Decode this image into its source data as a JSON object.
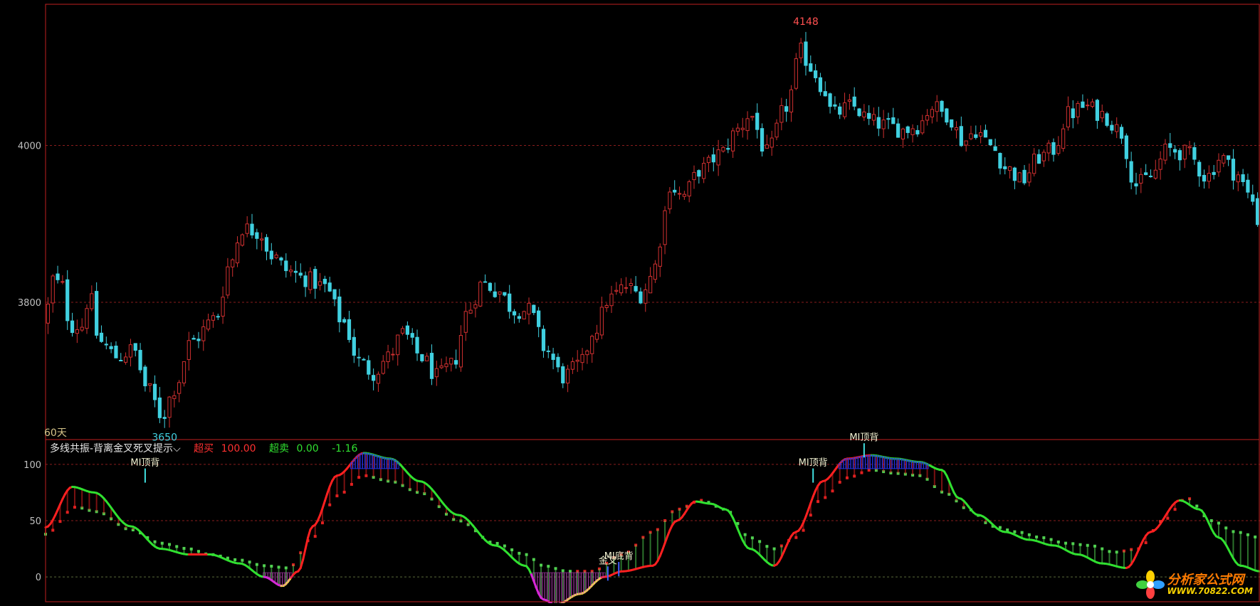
{
  "colors": {
    "up": "#d03030",
    "down": "#40d0e0",
    "frame": "#c02020",
    "grid": "#8a1c1c",
    "zero_grid": "#5a6a3a",
    "axis_text": "#c0c0c0",
    "fast_up": "#ff2020",
    "fast_down": "#30e030",
    "slow_up": "#e02020",
    "slow_down": "#50d050",
    "overbought_box": "#2030e0",
    "oversold_box": "#c040c0"
  },
  "price_panel": {
    "period_label": "60天",
    "high_label": "4148",
    "low_label": "3650"
  },
  "indicator_header": {
    "name": "多线共振-背离金叉死叉提示",
    "chevron": "⌵",
    "overbought_label": "超买",
    "overbought_value": "100.00",
    "oversold_label": "超卖",
    "oversold_value": "0.00",
    "current_value": "-1.16"
  },
  "annotations": [
    {
      "x": 82,
      "text": "MI顶背"
    },
    {
      "x": 463,
      "text": "金叉"
    },
    {
      "x": 472,
      "text": "MI底背"
    },
    {
      "x": 632,
      "text": "MI顶背"
    },
    {
      "x": 674,
      "text": "MI顶背"
    }
  ],
  "watermark": {
    "title": "分析家公式网",
    "url": "WWW.70822.COM"
  },
  "chart_data": [
    {
      "type": "candlestick",
      "y_ticks": [
        3800,
        4000
      ],
      "ylim": [
        3625,
        4180
      ],
      "grid": true,
      "x_range": [
        0,
        1000
      ],
      "price_anchors": [
        [
          0,
          3775
        ],
        [
          5,
          3830
        ],
        [
          14,
          3820
        ],
        [
          20,
          3770
        ],
        [
          30,
          3770
        ],
        [
          36,
          3810
        ],
        [
          44,
          3750
        ],
        [
          60,
          3730
        ],
        [
          72,
          3740
        ],
        [
          84,
          3690
        ],
        [
          96,
          3655
        ],
        [
          106,
          3690
        ],
        [
          120,
          3750
        ],
        [
          140,
          3780
        ],
        [
          152,
          3850
        ],
        [
          162,
          3895
        ],
        [
          176,
          3890
        ],
        [
          186,
          3860
        ],
        [
          200,
          3840
        ],
        [
          214,
          3830
        ],
        [
          230,
          3820
        ],
        [
          245,
          3775
        ],
        [
          258,
          3725
        ],
        [
          270,
          3710
        ],
        [
          282,
          3730
        ],
        [
          294,
          3760
        ],
        [
          310,
          3730
        ],
        [
          322,
          3705
        ],
        [
          335,
          3720
        ],
        [
          348,
          3790
        ],
        [
          360,
          3825
        ],
        [
          372,
          3815
        ],
        [
          386,
          3790
        ],
        [
          398,
          3790
        ],
        [
          412,
          3740
        ],
        [
          426,
          3705
        ],
        [
          440,
          3720
        ],
        [
          452,
          3765
        ],
        [
          464,
          3805
        ],
        [
          478,
          3820
        ],
        [
          490,
          3810
        ],
        [
          500,
          3835
        ],
        [
          506,
          3880
        ],
        [
          514,
          3950
        ],
        [
          524,
          3935
        ],
        [
          540,
          3970
        ],
        [
          556,
          3990
        ],
        [
          570,
          4020
        ],
        [
          580,
          4040
        ],
        [
          594,
          3990
        ],
        [
          610,
          4050
        ],
        [
          622,
          4120
        ],
        [
          630,
          4100
        ],
        [
          640,
          4075
        ],
        [
          648,
          4040
        ],
        [
          664,
          4050
        ],
        [
          680,
          4030
        ],
        [
          694,
          4025
        ],
        [
          706,
          4020
        ],
        [
          718,
          4025
        ],
        [
          730,
          4050
        ],
        [
          742,
          4040
        ],
        [
          756,
          4005
        ],
        [
          766,
          4020
        ],
        [
          778,
          4000
        ],
        [
          792,
          3970
        ],
        [
          804,
          3955
        ],
        [
          818,
          3985
        ],
        [
          830,
          3995
        ],
        [
          842,
          4040
        ],
        [
          856,
          4050
        ],
        [
          870,
          4040
        ],
        [
          884,
          4020
        ],
        [
          898,
          3950
        ],
        [
          910,
          3960
        ],
        [
          924,
          3995
        ],
        [
          940,
          3990
        ],
        [
          956,
          3960
        ],
        [
          968,
          3985
        ],
        [
          980,
          3965
        ],
        [
          992,
          3935
        ],
        [
          1000,
          3900
        ]
      ]
    },
    {
      "type": "line",
      "y_ticks": [
        0,
        50,
        100
      ],
      "ylim": [
        -22,
        122
      ],
      "grid": true,
      "x_range": [
        0,
        1000
      ],
      "series": [
        {
          "values": [
            [
              0,
              44
            ],
            [
              22,
              80
            ],
            [
              40,
              75
            ],
            [
              70,
              45
            ],
            [
              95,
              25
            ],
            [
              118,
              20
            ],
            [
              135,
              20
            ],
            [
              160,
              12
            ],
            [
              180,
              0
            ],
            [
              195,
              -8
            ],
            [
              208,
              5
            ],
            [
              220,
              45
            ],
            [
              240,
              90
            ],
            [
              262,
              110
            ],
            [
              284,
              105
            ],
            [
              308,
              85
            ],
            [
              340,
              55
            ],
            [
              370,
              28
            ],
            [
              395,
              10
            ],
            [
              410,
              -20
            ],
            [
              420,
              -25
            ],
            [
              440,
              -15
            ],
            [
              460,
              0
            ],
            [
              475,
              5
            ],
            [
              500,
              10
            ],
            [
              520,
              50
            ],
            [
              535,
              67
            ],
            [
              548,
              65
            ],
            [
              560,
              60
            ],
            [
              580,
              25
            ],
            [
              600,
              10
            ],
            [
              618,
              40
            ],
            [
              640,
              85
            ],
            [
              660,
              105
            ],
            [
              680,
              108
            ],
            [
              700,
              105
            ],
            [
              720,
              102
            ],
            [
              738,
              95
            ],
            [
              752,
              70
            ],
            [
              768,
              55
            ],
            [
              790,
              40
            ],
            [
              810,
              33
            ],
            [
              830,
              28
            ],
            [
              850,
              20
            ],
            [
              870,
              12
            ],
            [
              890,
              8
            ],
            [
              910,
              40
            ],
            [
              934,
              68
            ],
            [
              950,
              60
            ],
            [
              966,
              35
            ],
            [
              984,
              10
            ],
            [
              1000,
              5
            ]
          ]
        },
        {
          "values": [
            [
              0,
              38
            ],
            [
              25,
              62
            ],
            [
              42,
              58
            ],
            [
              70,
              42
            ],
            [
              95,
              30
            ],
            [
              118,
              25
            ],
            [
              135,
              20
            ],
            [
              160,
              15
            ],
            [
              180,
              10
            ],
            [
              200,
              8
            ],
            [
              220,
              35
            ],
            [
              240,
              72
            ],
            [
              262,
              90
            ],
            [
              284,
              85
            ],
            [
              308,
              75
            ],
            [
              340,
              50
            ],
            [
              370,
              30
            ],
            [
              395,
              20
            ],
            [
              410,
              10
            ],
            [
              430,
              5
            ],
            [
              450,
              5
            ],
            [
              475,
              20
            ],
            [
              500,
              40
            ],
            [
              520,
              60
            ],
            [
              540,
              68
            ],
            [
              560,
              60
            ],
            [
              580,
              35
            ],
            [
              600,
              25
            ],
            [
              618,
              35
            ],
            [
              640,
              70
            ],
            [
              660,
              88
            ],
            [
              680,
              95
            ],
            [
              700,
              92
            ],
            [
              720,
              90
            ],
            [
              740,
              75
            ],
            [
              760,
              60
            ],
            [
              780,
              45
            ],
            [
              800,
              40
            ],
            [
              820,
              35
            ],
            [
              840,
              30
            ],
            [
              860,
              28
            ],
            [
              880,
              22
            ],
            [
              900,
              25
            ],
            [
              920,
              50
            ],
            [
              940,
              70
            ],
            [
              960,
              50
            ],
            [
              980,
              40
            ],
            [
              1000,
              35
            ]
          ]
        }
      ]
    }
  ]
}
